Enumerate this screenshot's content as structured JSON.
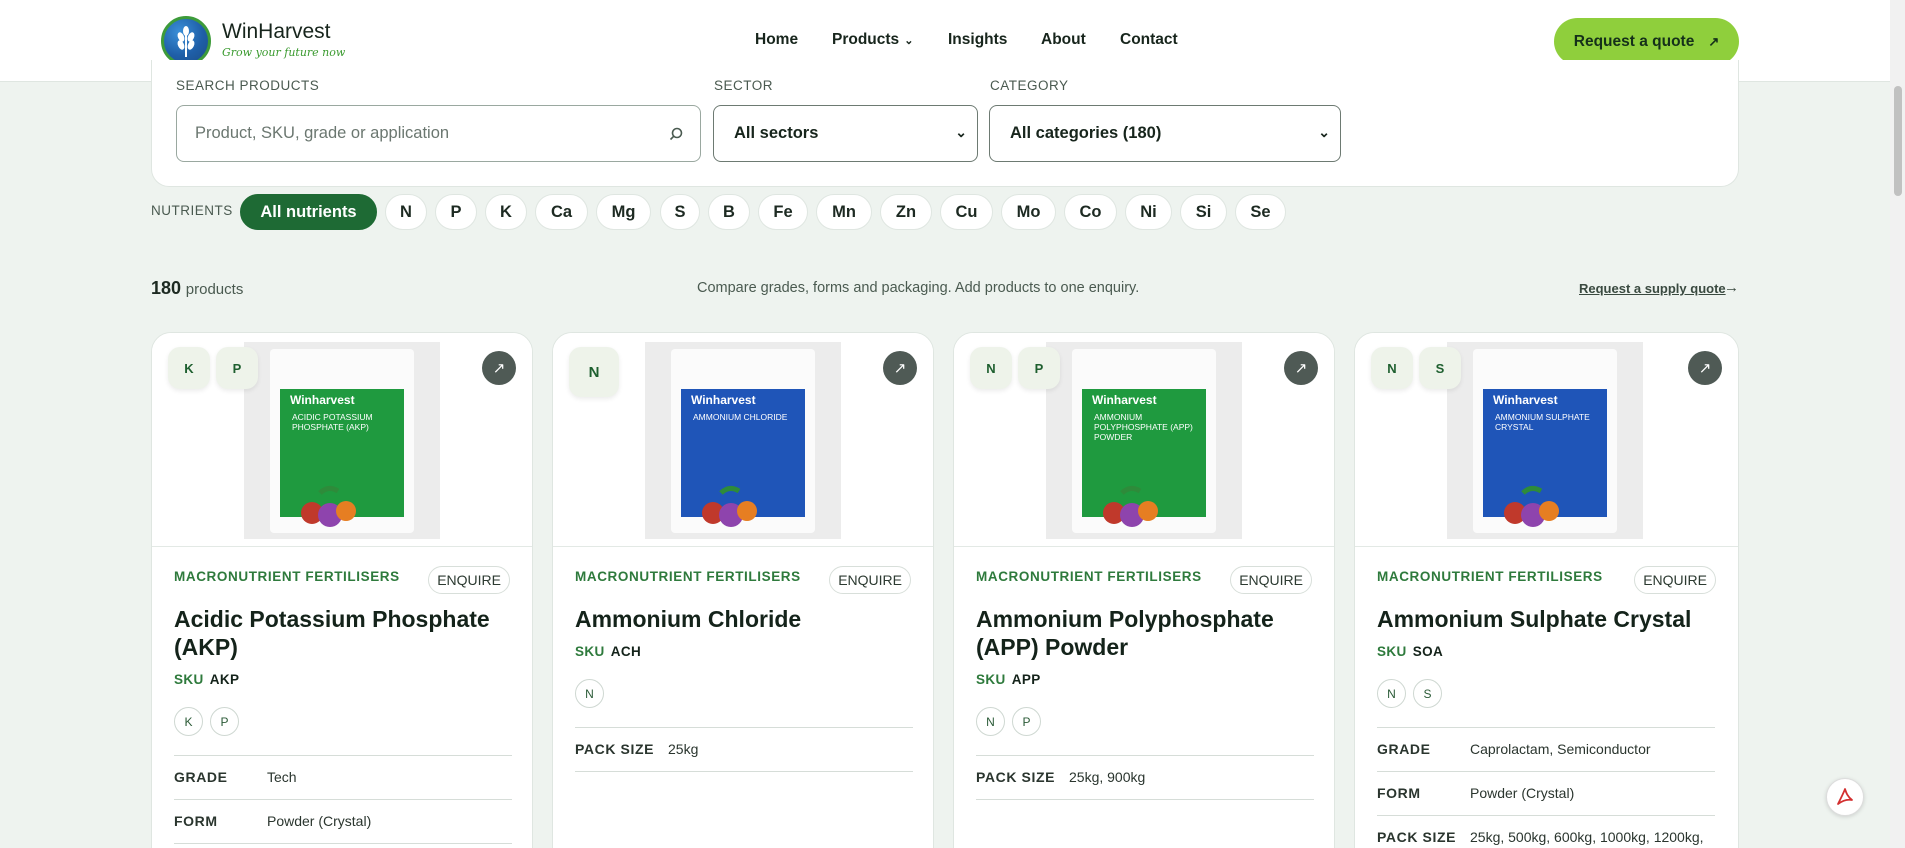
{
  "brand": {
    "name": "WinHarvest",
    "tagline": "Grow your future now"
  },
  "nav": {
    "items": [
      "Home",
      "Products",
      "Insights",
      "About",
      "Contact"
    ],
    "caret": "⌄"
  },
  "header": {
    "quote_label": "Request a quote",
    "quote_arrow": "↗"
  },
  "filters": {
    "search_label": "SEARCH PRODUCTS",
    "search_placeholder": "Product, SKU, grade or application",
    "sector_label": "SECTOR",
    "sector_value": "All sectors",
    "category_label": "CATEGORY",
    "category_value": "All categories (180)"
  },
  "nutrients": {
    "label": "NUTRIENTS",
    "chips": [
      "All nutrients",
      "N",
      "P",
      "K",
      "Ca",
      "Mg",
      "S",
      "B",
      "Fe",
      "Mn",
      "Zn",
      "Cu",
      "Mo",
      "Co",
      "Ni",
      "Si",
      "Se"
    ],
    "active": "All nutrients"
  },
  "results": {
    "count": "180",
    "count_suffix": "products",
    "compare_text": "Compare grades, forms and packaging. Add products to one enquiry.",
    "supply_link": "Request a supply quote",
    "supply_arrow": "→"
  },
  "products": [
    {
      "category": "MACRONUTRIENT FERTILISERS",
      "enquire": "ENQUIRE",
      "name": "Acidic Potassium Phosphate (AKP)",
      "sku_label": "SKU",
      "sku": "AKP",
      "tags": [
        "K",
        "P"
      ],
      "bag_brand": "Winharvest",
      "bag_name": "ACIDIC POTASSIUM PHOSPHATE (AKP)",
      "bag_color": "#1f9a3f",
      "specs": [
        {
          "key": "GRADE",
          "value": "Tech"
        },
        {
          "key": "FORM",
          "value": "Powder (Crystal)"
        }
      ]
    },
    {
      "category": "MACRONUTRIENT FERTILISERS",
      "enquire": "ENQUIRE",
      "name": "Ammonium Chloride",
      "sku_label": "SKU",
      "sku": "ACH",
      "tags": [
        "N"
      ],
      "bag_brand": "Winharvest",
      "bag_name": "AMMONIUM CHLORIDE",
      "bag_color": "#1f55b8",
      "specs": [
        {
          "key": "PACK SIZE",
          "value": "25kg"
        }
      ]
    },
    {
      "category": "MACRONUTRIENT FERTILISERS",
      "enquire": "ENQUIRE",
      "name": "Ammonium Polyphosphate (APP) Powder",
      "sku_label": "SKU",
      "sku": "APP",
      "tags": [
        "N",
        "P"
      ],
      "bag_brand": "Winharvest",
      "bag_name": "AMMONIUM POLYPHOSPHATE (APP) POWDER",
      "bag_color": "#1f9a3f",
      "specs": [
        {
          "key": "PACK SIZE",
          "value": "25kg, 900kg"
        }
      ]
    },
    {
      "category": "MACRONUTRIENT FERTILISERS",
      "enquire": "ENQUIRE",
      "name": "Ammonium Sulphate Crystal",
      "sku_label": "SKU",
      "sku": "SOA",
      "tags": [
        "N",
        "S"
      ],
      "bag_brand": "Winharvest",
      "bag_name": "AMMONIUM SULPHATE CRYSTAL",
      "bag_color": "#1f55b8",
      "specs": [
        {
          "key": "GRADE",
          "value": "Caprolactam, Semiconductor"
        },
        {
          "key": "FORM",
          "value": "Powder (Crystal)"
        },
        {
          "key": "PACK SIZE",
          "value": "25kg, 500kg, 600kg, 1000kg, 1200kg,"
        }
      ]
    }
  ],
  "icons": {
    "search": "search-icon",
    "expand": "↗",
    "pdf": "pdf-icon"
  }
}
